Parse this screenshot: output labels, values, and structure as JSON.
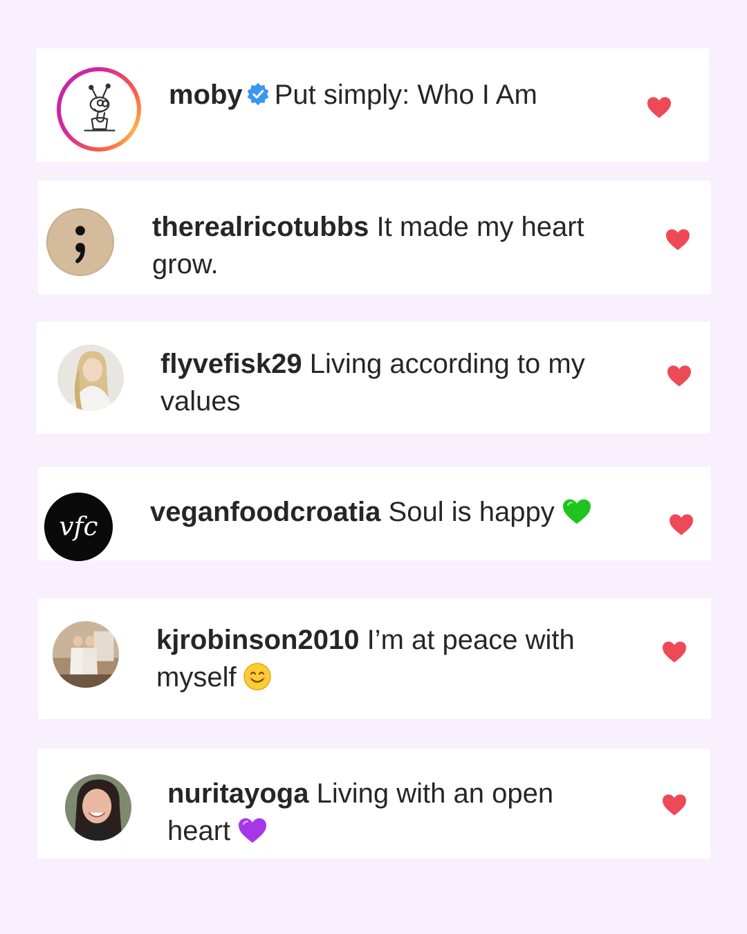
{
  "comments": [
    {
      "username": "moby",
      "verified": true,
      "text": "Put simply: Who I Am",
      "emoji": "",
      "avatar": "ant-drawing-avatar",
      "liked": true
    },
    {
      "username": "therealricotubbs",
      "verified": false,
      "text": "It made my heart grow.",
      "line1": "It made my heart",
      "line2": "grow.",
      "emoji": "",
      "avatar": "semicolon-avatar",
      "liked": true
    },
    {
      "username": "flyvefisk29",
      "verified": false,
      "line1": "Living according to my",
      "line2": "values",
      "emoji": "",
      "avatar": "photo-avatar",
      "liked": true
    },
    {
      "username": "veganfoodcroatia",
      "verified": false,
      "text": "Soul is happy",
      "emoji": "green-heart",
      "avatar": "vfc-logo-avatar",
      "avatar_text": "vfc",
      "liked": true
    },
    {
      "username": "kjrobinson2010",
      "verified": false,
      "line1": "I’m at peace with",
      "line2": "myself",
      "emoji": "smiling-face",
      "avatar": "photo-avatar",
      "liked": true
    },
    {
      "username": "nuritayoga",
      "verified": false,
      "line1": "Living with an open",
      "line2": "heart",
      "emoji": "purple-heart",
      "avatar": "photo-avatar",
      "liked": true
    }
  ],
  "colors": {
    "background": "#f8f0fc",
    "card": "#ffffff",
    "heart": "#ed4956",
    "verified": "#3897f0"
  }
}
